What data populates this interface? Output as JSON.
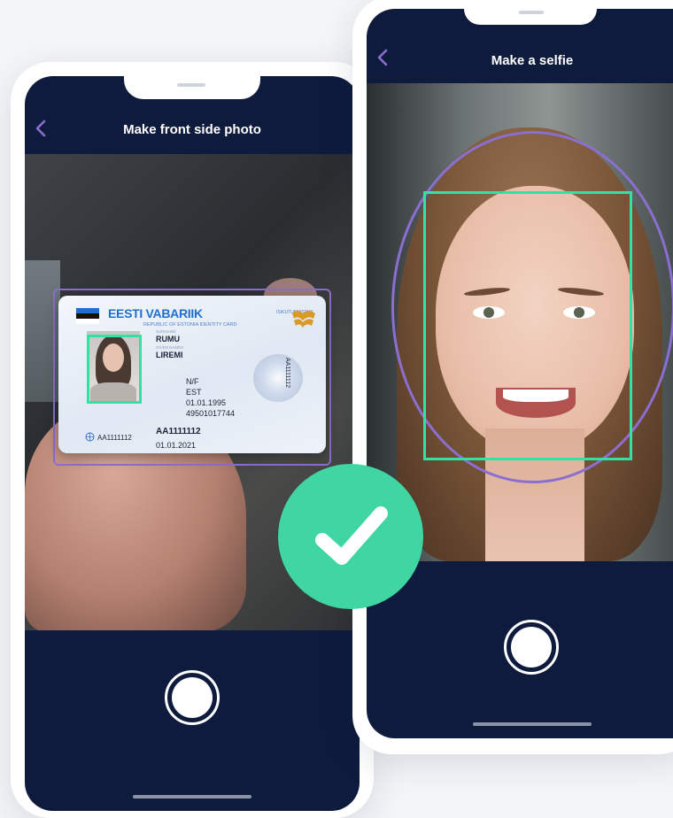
{
  "left_phone": {
    "title": "Make front side photo",
    "card": {
      "country": "EESTI VABARIIK",
      "subtitle": "REPUBLIC OF ESTONIA IDENTITY CARD",
      "doc_type": "ISIKUTUNNISTUS",
      "surname": "RUMU",
      "given_name": "LIREMI",
      "sex": "N/F",
      "nationality": "EST",
      "birth_date": "01.01.1995",
      "personal_code": "49501017744",
      "doc_number": "AA1111112",
      "doc_number_small": "AA1111112",
      "expiry": "01.01.2021",
      "side_number": "AA1111112"
    }
  },
  "right_phone": {
    "title": "Make a selfie"
  },
  "colors": {
    "screen_bg": "#0f1b3d",
    "accent_green": "#2fe3a5",
    "accent_purple": "#8b6fd0",
    "check_green": "#3fd6a3"
  },
  "icons": {
    "back": "chevron-left-icon",
    "success": "checkmark-icon",
    "shutter": "shutter-button"
  }
}
